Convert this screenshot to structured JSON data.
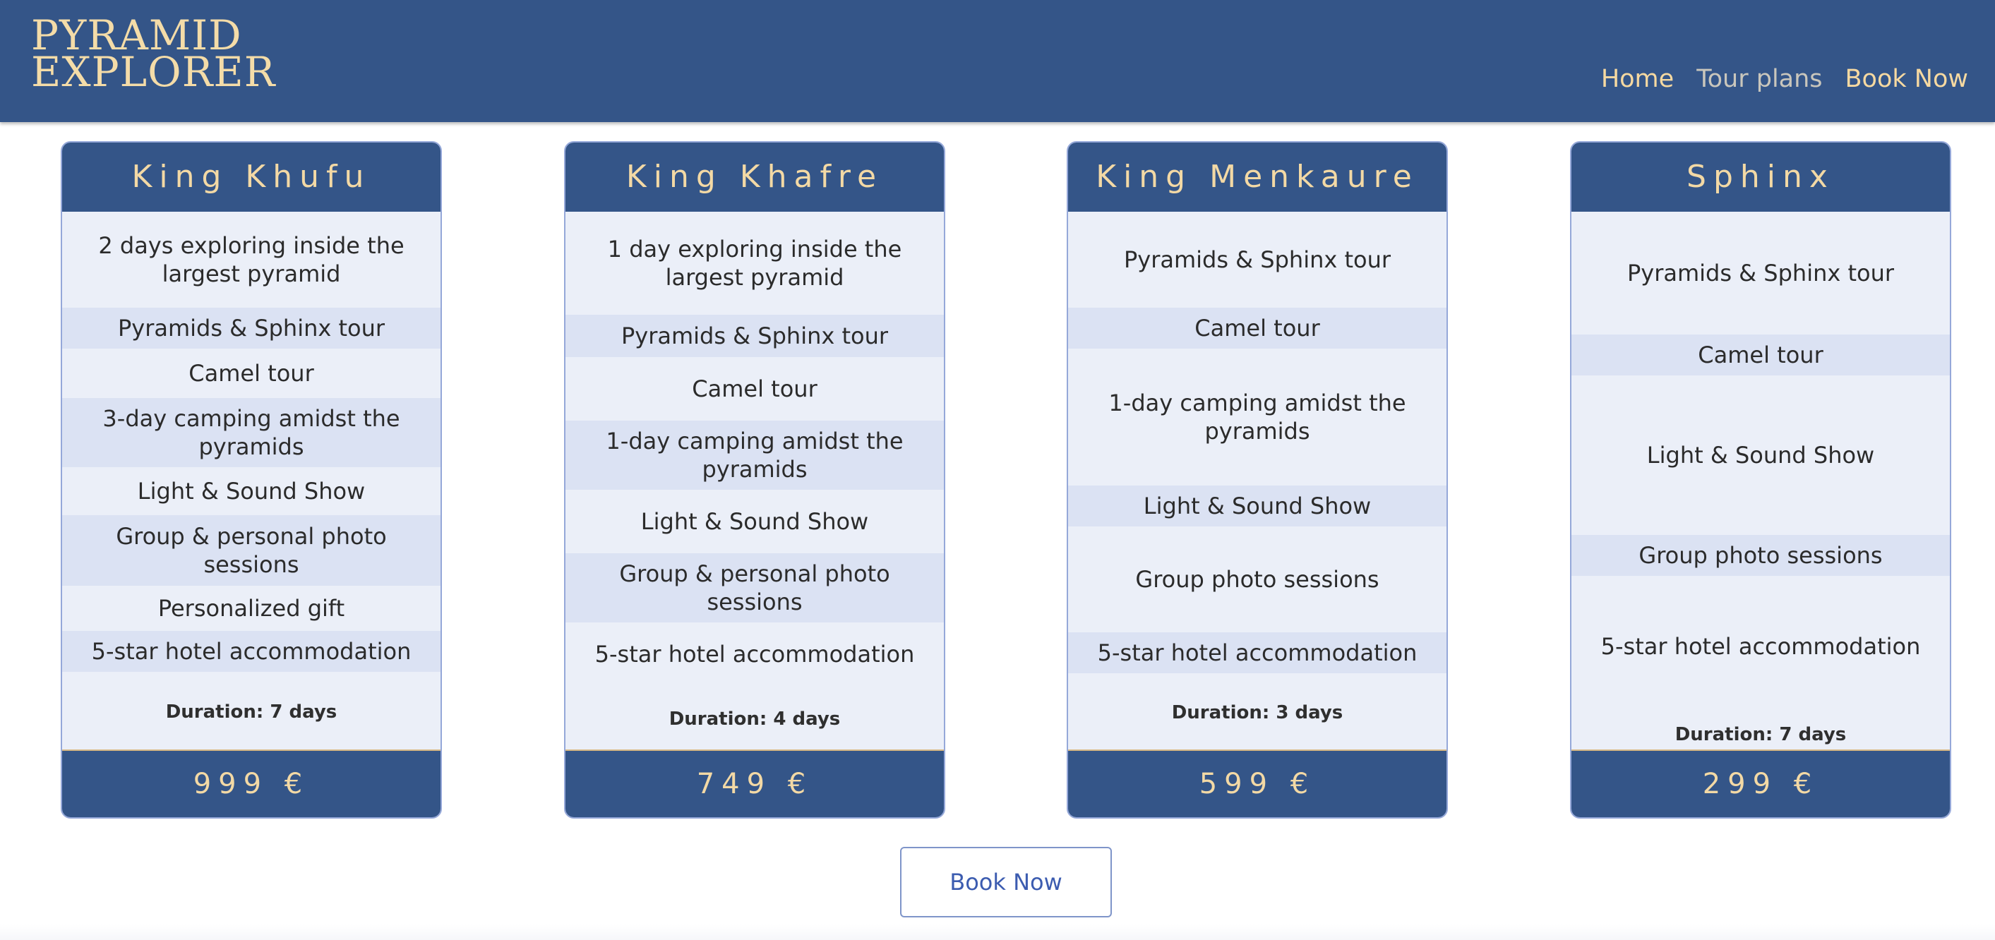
{
  "brand": {
    "line1": "PYRAMID",
    "line2": "EXPLORER"
  },
  "nav": [
    {
      "label": "Home"
    },
    {
      "label": "Tour plans"
    },
    {
      "label": "Book Now"
    }
  ],
  "plans": [
    {
      "title": "King Khufu",
      "features": [
        "2 days exploring inside the largest pyramid",
        "Pyramids & Sphinx tour",
        "Camel tour",
        "3-day camping amidst the pyramids",
        "Light & Sound Show",
        "Group & personal photo sessions",
        "Personalized gift",
        "5-star hotel accommodation"
      ],
      "duration": "Duration: 7 days",
      "price": "999 €"
    },
    {
      "title": "King Khafre",
      "features": [
        "1 day exploring inside the largest pyramid",
        "Pyramids & Sphinx tour",
        "Camel tour",
        "1-day camping amidst the pyramids",
        "Light & Sound Show",
        "Group & personal photo sessions",
        "5-star hotel accommodation"
      ],
      "duration": "Duration: 4 days",
      "price": "749 €"
    },
    {
      "title": "King Menkaure",
      "features": [
        "Pyramids & Sphinx tour",
        "Camel tour",
        "1-day camping amidst the pyramids",
        "Light & Sound Show",
        "Group photo sessions",
        "5-star hotel accommodation"
      ],
      "duration": "Duration: 3 days",
      "price": "599 €"
    },
    {
      "title": "Sphinx",
      "features": [
        "Pyramids & Sphinx tour",
        "Camel tour",
        "Light & Sound Show",
        "Group photo sessions",
        "5-star hotel accommodation"
      ],
      "duration": "Duration: 7 days",
      "price": "299 €"
    }
  ],
  "book_button": {
    "label": "Book Now"
  },
  "colors": {
    "primary": "#345588",
    "accent": "#f3d9a5",
    "row_light": "#ebeff8",
    "row_alt": "#dbe2f3",
    "button_text": "#3c5cb0"
  }
}
